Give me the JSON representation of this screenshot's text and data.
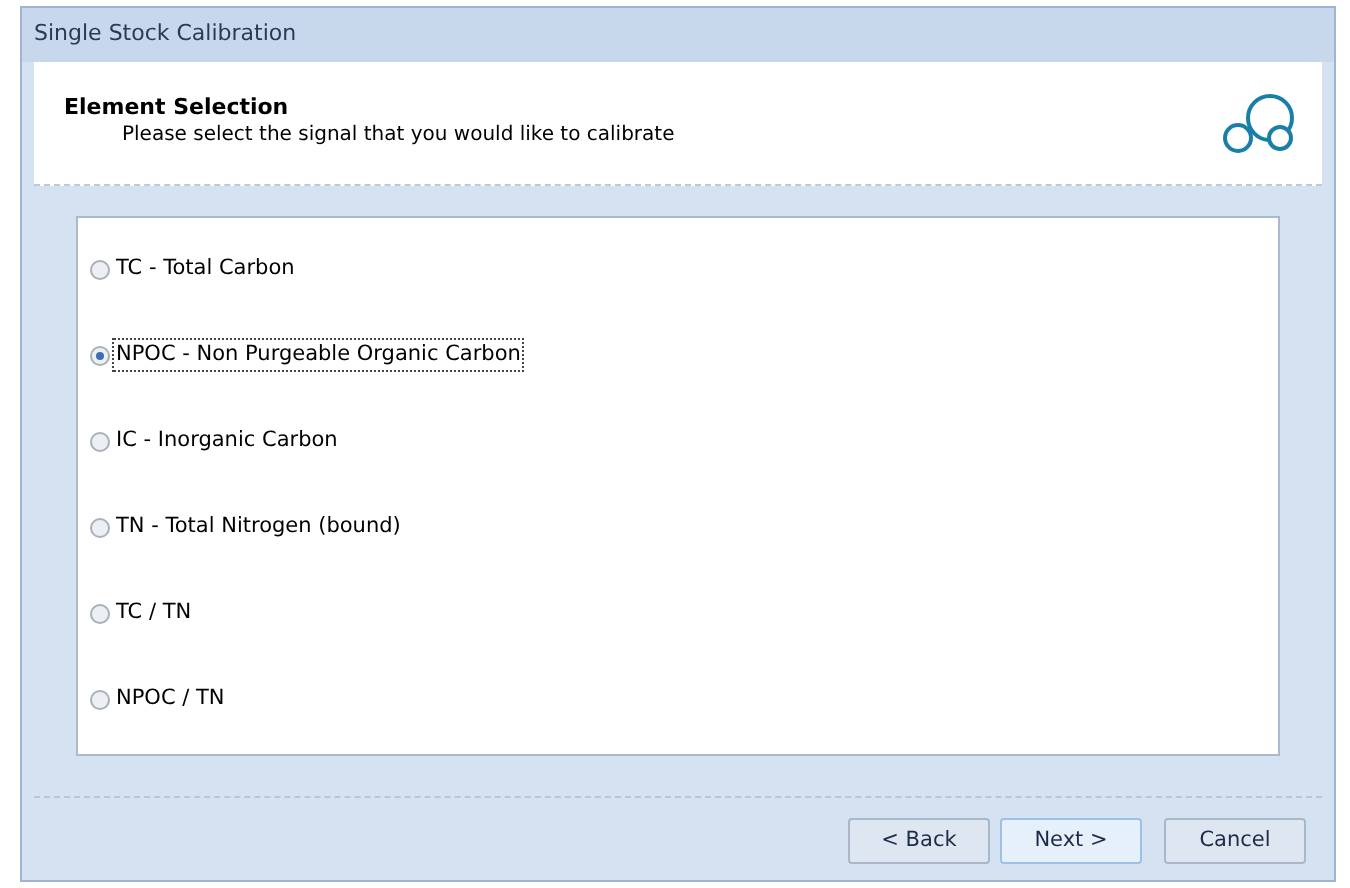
{
  "window": {
    "title": "Single Stock Calibration"
  },
  "header": {
    "title": "Element Selection",
    "subtitle": "Please select the signal that you would like to calibrate"
  },
  "options": [
    {
      "label": "TC - Total Carbon",
      "selected": false
    },
    {
      "label": "NPOC - Non Purgeable Organic Carbon",
      "selected": true
    },
    {
      "label": "IC - Inorganic Carbon",
      "selected": false
    },
    {
      "label": "TN - Total Nitrogen (bound)",
      "selected": false
    },
    {
      "label": "TC / TN",
      "selected": false
    },
    {
      "label": "NPOC / TN",
      "selected": false
    }
  ],
  "buttons": [
    {
      "label": "< Back",
      "default": false
    },
    {
      "label": "Next >",
      "default": true
    },
    {
      "label": "Cancel",
      "default": false
    }
  ]
}
